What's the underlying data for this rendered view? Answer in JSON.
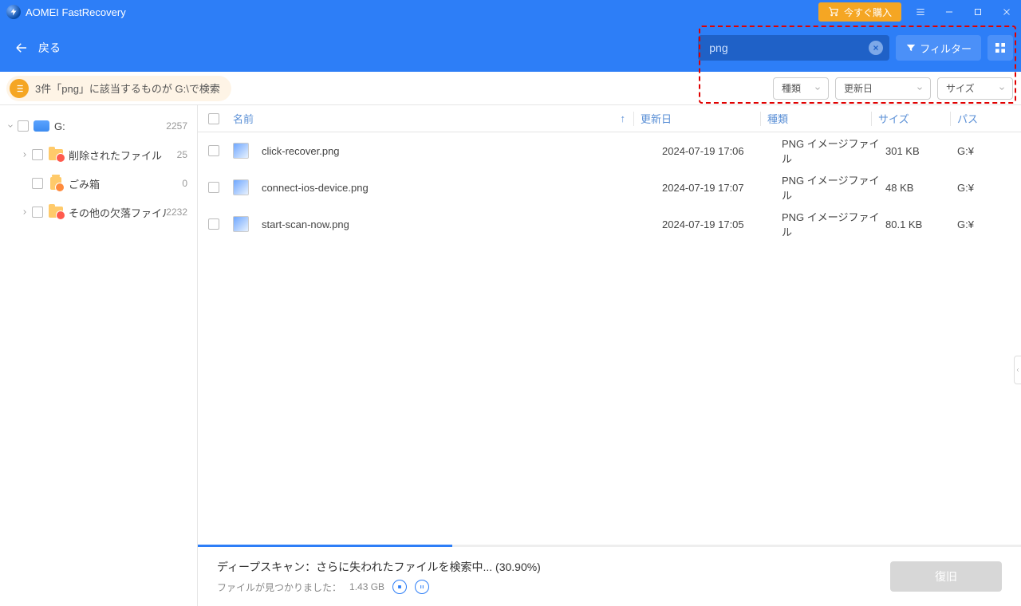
{
  "app": {
    "title": "AOMEI FastRecovery",
    "buy_label": "今すぐ購入",
    "back_label": "戻る"
  },
  "search": {
    "value": "png",
    "filter_label": "フィルター"
  },
  "info_bar": {
    "text": "3件「png」に該当するものが G:\\で検索"
  },
  "dropdowns": {
    "type": "種類",
    "modified": "更新日",
    "size": "サイズ"
  },
  "tree": {
    "root": {
      "label": "G:",
      "count": "2257"
    },
    "items": [
      {
        "label": "削除されたファイル",
        "count": "25",
        "icon": "folder-red",
        "expandable": true
      },
      {
        "label": "ごみ箱",
        "count": "0",
        "icon": "trash",
        "expandable": false
      },
      {
        "label": "その他の欠落ファイル",
        "count": "2232",
        "icon": "folder-red",
        "expandable": true
      }
    ]
  },
  "columns": {
    "name": "名前",
    "date": "更新日",
    "type": "種類",
    "size": "サイズ",
    "path": "パス"
  },
  "rows": [
    {
      "name": "click-recover.png",
      "date": "2024-07-19 17:06",
      "type": "PNG イメージファイル",
      "size": "301 KB",
      "path": "G:¥"
    },
    {
      "name": "connect-ios-device.png",
      "date": "2024-07-19 17:07",
      "type": "PNG イメージファイル",
      "size": "48 KB",
      "path": "G:¥"
    },
    {
      "name": "start-scan-now.png",
      "date": "2024-07-19 17:05",
      "type": "PNG イメージファイル",
      "size": "80.1 KB",
      "path": "G:¥"
    }
  ],
  "footer": {
    "title": "ディープスキャン：さらに失われたファイルを検索中... (30.90%)",
    "sub_label": "ファイルが見つかりました：",
    "found_size": "1.43 GB",
    "recover_label": "復旧",
    "progress_pct": 30.9
  }
}
